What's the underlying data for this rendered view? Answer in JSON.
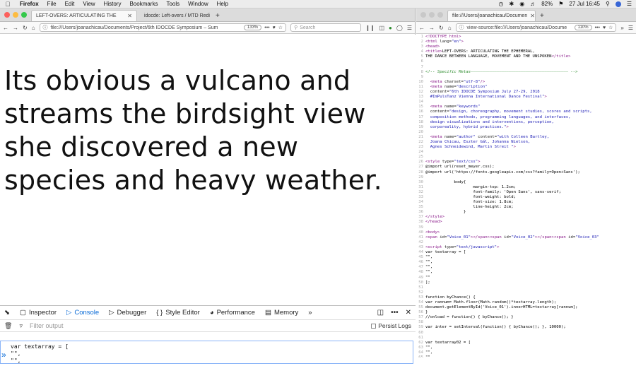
{
  "menubar": {
    "app": "Firefox",
    "items": [
      "File",
      "Edit",
      "View",
      "History",
      "Bookmarks",
      "Tools",
      "Window",
      "Help"
    ],
    "battery": "82%",
    "datetime": "27 Jul 16:45"
  },
  "left_window": {
    "tabs": [
      {
        "label": "LEFT-OVERS: ARTICULATING THE"
      },
      {
        "label": "idocde: Left-overs / MTD Redi"
      }
    ],
    "url": "file:///Users/joanachicau/Documents/Project/6th IDOCDE Symposium – Sum",
    "zoom": "133%",
    "search_placeholder": "Search",
    "body_lines": [
      "Its obvious a vulcano and",
      "streams the birdsight view",
      "she discovered a new",
      "species and heavy weather."
    ],
    "devtools": {
      "tabs": [
        "Inspector",
        "Console",
        "Debugger",
        "Style Editor",
        "Performance",
        "Memory"
      ],
      "filter_placeholder": "Filter output",
      "persist_logs": "Persist Logs",
      "console_lines": [
        "var textarray = [",
        "\"\",",
        "\"\","
      ]
    }
  },
  "right_window": {
    "tab_label": "file:///Users/joanachicau/Documen",
    "url": "view-source:file:///Users/joanachicau/Docume",
    "zoom": "110%",
    "source_lines": [
      {
        "n": "1",
        "t": [
          [
            "tag",
            "<!DOCTYPE html>"
          ]
        ]
      },
      {
        "n": "2",
        "t": [
          [
            "tag",
            "<html "
          ],
          [
            "attr",
            "lang="
          ],
          [
            "val",
            "\"en\""
          ],
          [
            "tag",
            ">"
          ]
        ]
      },
      {
        "n": "3",
        "t": [
          [
            "tag",
            "<head>"
          ]
        ]
      },
      {
        "n": "4",
        "t": [
          [
            "tag",
            "<title>"
          ],
          [
            "txt",
            "LEFT-OVERS: ARTICULATING THE EPHEMERAL,"
          ]
        ]
      },
      {
        "n": "5",
        "t": [
          [
            "txt",
            "THE DANCE BETWEEN LANGUAGE, MOVEMENT AND THE UNSPOKEN"
          ],
          [
            "tag",
            "</title>"
          ]
        ]
      },
      {
        "n": "6",
        "t": []
      },
      {
        "n": "7",
        "t": []
      },
      {
        "n": "8",
        "t": [
          [
            "com",
            "<!-- Specific Metas————————————————————————————————————————— -->"
          ]
        ]
      },
      {
        "n": "9",
        "t": []
      },
      {
        "n": "10",
        "t": [
          [
            "txt",
            "  "
          ],
          [
            "tag",
            "<meta "
          ],
          [
            "attr",
            "charset="
          ],
          [
            "val",
            "\"utf-8\""
          ],
          [
            "tag",
            "/>"
          ]
        ]
      },
      {
        "n": "11",
        "t": [
          [
            "txt",
            "  "
          ],
          [
            "tag",
            "<meta "
          ],
          [
            "attr",
            "name="
          ],
          [
            "val",
            "\"description\""
          ]
        ]
      },
      {
        "n": "12",
        "t": [
          [
            "txt",
            "  "
          ],
          [
            "attr",
            "content="
          ],
          [
            "val",
            "\"6th IDOCDE Symposium July 27-29, 2018"
          ]
        ]
      },
      {
        "n": "13",
        "t": [
          [
            "val",
            "  #ImPulsTanz Vienna International Dance Festival\""
          ],
          [
            "tag",
            ">"
          ]
        ]
      },
      {
        "n": "14",
        "t": []
      },
      {
        "n": "15",
        "t": [
          [
            "txt",
            "  "
          ],
          [
            "tag",
            "<meta "
          ],
          [
            "attr",
            "name="
          ],
          [
            "val",
            "\"keywords\""
          ]
        ]
      },
      {
        "n": "16",
        "t": [
          [
            "txt",
            "  "
          ],
          [
            "attr",
            "content="
          ],
          [
            "val",
            "\"design, choreography, movement studies, scores and scripts,"
          ]
        ]
      },
      {
        "n": "17",
        "t": [
          [
            "val",
            "  composition methods, programming languages, and interfaces,"
          ]
        ]
      },
      {
        "n": "18",
        "t": [
          [
            "val",
            "  design visualizations and interventions, perception,"
          ]
        ]
      },
      {
        "n": "19",
        "t": [
          [
            "val",
            "  corporeality, hybrid practices.\""
          ],
          [
            "tag",
            ">"
          ]
        ]
      },
      {
        "n": "20",
        "t": []
      },
      {
        "n": "21",
        "t": [
          [
            "txt",
            "  "
          ],
          [
            "tag",
            "<meta "
          ],
          [
            "attr",
            "name="
          ],
          [
            "val",
            "\"author\" "
          ],
          [
            "attr",
            "content="
          ],
          [
            "val",
            "\"with Colleen Bartley,"
          ]
        ]
      },
      {
        "n": "22",
        "t": [
          [
            "val",
            "  Joana Chicau, Eszter Gál, Johanna Nielson,"
          ]
        ]
      },
      {
        "n": "23",
        "t": [
          [
            "val",
            "  Agnes Schneidewind, Martin Streit \""
          ],
          [
            "tag",
            ">"
          ]
        ]
      },
      {
        "n": "24",
        "t": []
      },
      {
        "n": "25",
        "t": []
      },
      {
        "n": "26",
        "t": [
          [
            "tag",
            "<style "
          ],
          [
            "attr",
            "type="
          ],
          [
            "val",
            "\"text/css\""
          ],
          [
            "tag",
            ">"
          ]
        ]
      },
      {
        "n": "27",
        "t": [
          [
            "txt",
            "@import url(reset_meyer.css);"
          ]
        ]
      },
      {
        "n": "28",
        "t": [
          [
            "txt",
            "@import url('https://fonts.googleapis.com/css?family=Open+Sans');"
          ]
        ]
      },
      {
        "n": "29",
        "t": []
      },
      {
        "n": "30",
        "t": [
          [
            "txt",
            "            body{"
          ]
        ]
      },
      {
        "n": "31",
        "t": [
          [
            "txt",
            "                    margin-top: 1.2cm;"
          ]
        ]
      },
      {
        "n": "32",
        "t": [
          [
            "txt",
            "                    font-family: 'Open Sans', sans-serif;"
          ]
        ]
      },
      {
        "n": "33",
        "t": [
          [
            "txt",
            "                    font-weight: bold;"
          ]
        ]
      },
      {
        "n": "34",
        "t": [
          [
            "txt",
            "                    font-size: 1.8cm;"
          ]
        ]
      },
      {
        "n": "35",
        "t": [
          [
            "txt",
            "                    line-height: 2cm;"
          ]
        ]
      },
      {
        "n": "36",
        "t": [
          [
            "txt",
            "                }"
          ]
        ]
      },
      {
        "n": "37",
        "t": [
          [
            "tag",
            "</style>"
          ]
        ]
      },
      {
        "n": "38",
        "t": [
          [
            "tag",
            "</head>"
          ]
        ]
      },
      {
        "n": "39",
        "t": []
      },
      {
        "n": "40",
        "t": [
          [
            "tag",
            "<body>"
          ]
        ]
      },
      {
        "n": "41",
        "t": [
          [
            "tag",
            "<span "
          ],
          [
            "attr",
            "id="
          ],
          [
            "val",
            "\"Voice_01\""
          ],
          [
            "tag",
            "></span><span "
          ],
          [
            "attr",
            "id="
          ],
          [
            "val",
            "\"Voice_02\""
          ],
          [
            "tag",
            "></span><span "
          ],
          [
            "attr",
            "id="
          ],
          [
            "val",
            "\"Voice_03\""
          ]
        ]
      },
      {
        "n": "42",
        "t": []
      },
      {
        "n": "43",
        "t": [
          [
            "tag",
            "<script "
          ],
          [
            "attr",
            "type="
          ],
          [
            "val",
            "\"text/javascript\""
          ],
          [
            "tag",
            ">"
          ]
        ]
      },
      {
        "n": "44",
        "t": [
          [
            "txt",
            "var textarray = ["
          ]
        ]
      },
      {
        "n": "45",
        "t": [
          [
            "txt",
            "\"\","
          ]
        ]
      },
      {
        "n": "46",
        "t": [
          [
            "txt",
            "\"\","
          ]
        ]
      },
      {
        "n": "47",
        "t": [
          [
            "txt",
            "\"\","
          ]
        ]
      },
      {
        "n": "48",
        "t": [
          [
            "txt",
            "\"\","
          ]
        ]
      },
      {
        "n": "49",
        "t": [
          [
            "txt",
            "\"\""
          ]
        ]
      },
      {
        "n": "50",
        "t": [
          [
            "txt",
            "];"
          ]
        ]
      },
      {
        "n": "51",
        "t": []
      },
      {
        "n": "52",
        "t": []
      },
      {
        "n": "53",
        "t": [
          [
            "txt",
            "function byChance() {"
          ]
        ]
      },
      {
        "n": "54",
        "t": [
          [
            "txt",
            "var rannum= Math.floor(Math.random()*textarray.length);"
          ]
        ]
      },
      {
        "n": "55",
        "t": [
          [
            "txt",
            "document.getElementById('Voice_01').innerHTML=textarray[rannum];"
          ]
        ]
      },
      {
        "n": "56",
        "t": [
          [
            "txt",
            "}"
          ]
        ]
      },
      {
        "n": "57",
        "t": [
          [
            "txt",
            "//onload = function() { byChance(); }"
          ]
        ]
      },
      {
        "n": "58",
        "t": []
      },
      {
        "n": "59",
        "t": [
          [
            "txt",
            "var inter = setInterval(function() { byChance(); }, 10000);"
          ]
        ]
      },
      {
        "n": "60",
        "t": []
      },
      {
        "n": "61",
        "t": []
      },
      {
        "n": "62",
        "t": [
          [
            "txt",
            "var textarray02 = ["
          ]
        ]
      },
      {
        "n": "63",
        "t": [
          [
            "txt",
            "\"\","
          ]
        ]
      },
      {
        "n": "64",
        "t": [
          [
            "txt",
            "\"\","
          ]
        ]
      },
      {
        "n": "65",
        "t": [
          [
            "txt",
            "\"\","
          ]
        ]
      }
    ]
  }
}
